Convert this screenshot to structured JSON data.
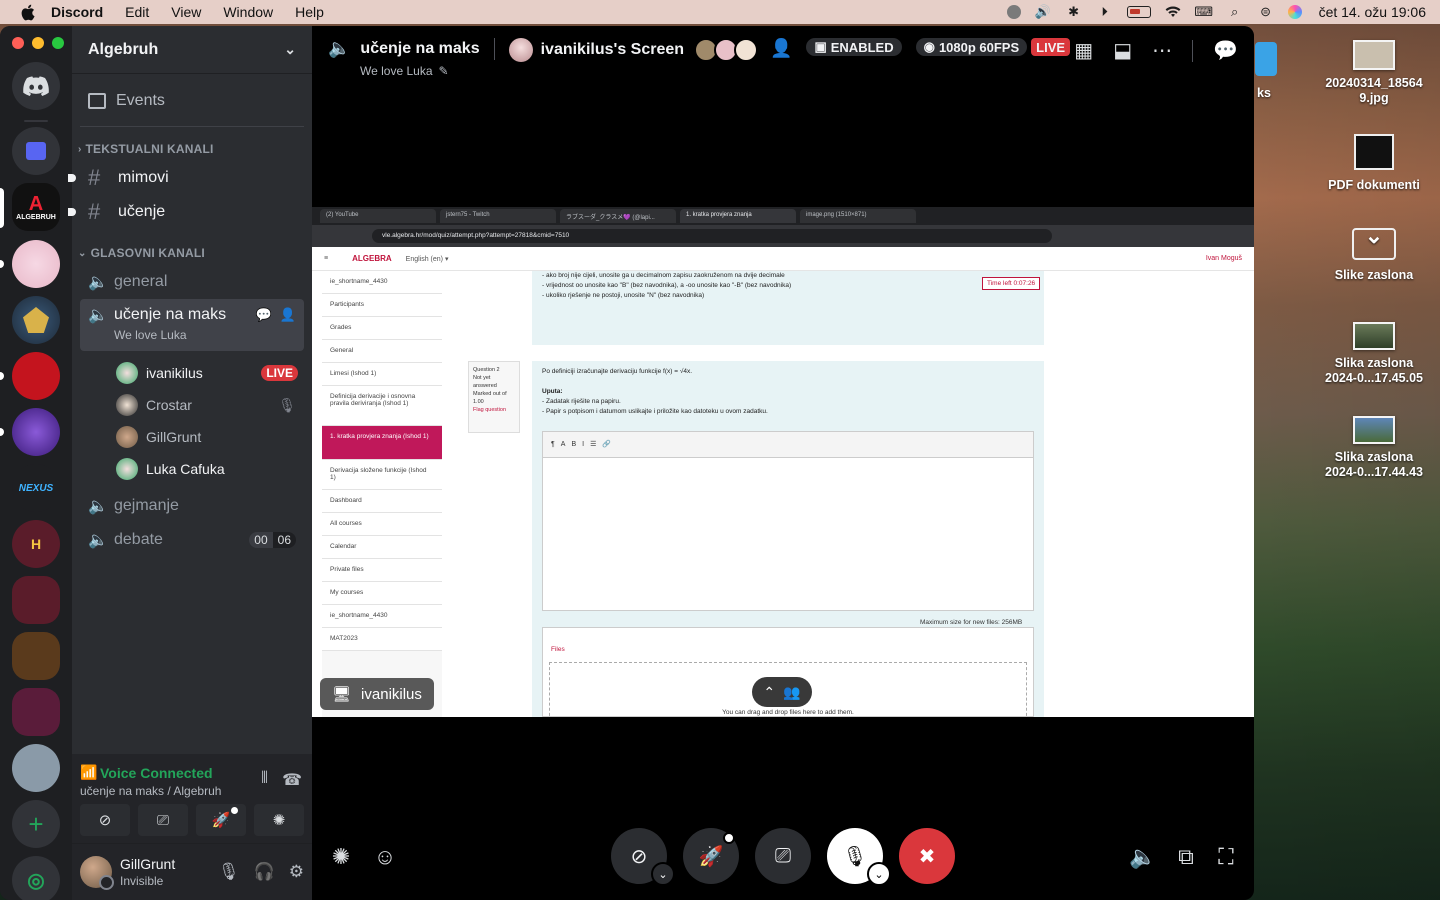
{
  "menubar": {
    "app_name": "Discord",
    "items": [
      "Edit",
      "View",
      "Window",
      "Help"
    ],
    "clock": "čet 14. ožu  19:06"
  },
  "desktop": {
    "items": [
      {
        "label": "20240314_18564\n9.jpg"
      },
      {
        "label": "PDF dokumenti"
      },
      {
        "label": "Slike zaslona"
      },
      {
        "label": "Slika zaslona\n2024-0...17.45.05"
      },
      {
        "label": "Slika zaslona\n2024-0...17.44.43"
      }
    ],
    "partial_label": "ks"
  },
  "server": {
    "name": "Algebruh",
    "events_label": "Events",
    "text_category": "TEKSTUALNI KANALI",
    "text_channels": [
      "mimovi",
      "učenje"
    ],
    "voice_category": "GLASOVNI KANALI",
    "voice_channels": {
      "general": "general",
      "active": {
        "name": "učenje na maks",
        "status": "We love Luka"
      },
      "gaming": "gejmanje",
      "debate": "debate",
      "debate_count": [
        "00",
        "06"
      ]
    },
    "vc_users": [
      {
        "name": "ivanikilus",
        "live": "LIVE"
      },
      {
        "name": "Crostar"
      },
      {
        "name": "GillGrunt"
      },
      {
        "name": "Luka Cafuka"
      }
    ]
  },
  "rail": {
    "algebruh_label": "ALGEBRUH",
    "nexus_label": "NEXUS",
    "h_label": "H"
  },
  "voice_panel": {
    "status": "Voice Connected",
    "where": "učenje na maks / Algebruh"
  },
  "user": {
    "name": "GillGrunt",
    "status": "Invisible"
  },
  "stage": {
    "channel": "učenje na maks",
    "channel_status": "We love Luka",
    "screen_title": "ivanikilus's Screen",
    "enabled_badge": "ENABLED",
    "quality_badge": "1080p 60FPS",
    "live_badge": "LIVE",
    "stream_tag": "ivanikilus"
  },
  "shared_screen": {
    "tabs": [
      "(2) YouTube",
      "jstern75 - Twitch",
      "ラブスーダ_クラスメ💜 (@lapi...",
      "1. kratka provjera znanja",
      "image.png (1510×871)"
    ],
    "url": "vle.algebra.hr/mod/quiz/attempt.php?attempt=27818&cmid=7510",
    "logo": "ALGEBRA",
    "language": "English (en) ▾",
    "user": "Ivan Moguš",
    "nav": [
      "ie_shortname_4430",
      "Participants",
      "Grades",
      "General",
      "Limesi (Ishod 1)",
      "Definicija derivacije i osnovna pravila deriviranja (Ishod 1)",
      "1. kratka provjera znanja (Ishod 1)",
      "Derivacija složene funkcije (Ishod 1)",
      "Dashboard",
      "All courses",
      "Calendar",
      "Private files",
      "My courses",
      "ie_shortname_4430",
      "MAT2023"
    ],
    "nav_selected": "1. kratka provjera znanja (Ishod 1)",
    "top_text": [
      "- ako broj nije cijeli, unosite ga u decimalnom zapisu zaokruženom na dvije decimale",
      "- vrijednost oo unosite kao \"B\" (bez navodnika), a -oo unosite kao \"-B\" (bez navodnika)",
      "- ukoliko rješenje ne postoji, unosite \"N\" (bez navodnika)"
    ],
    "time_left": "Time left 0:07:26",
    "question_info": [
      "Question 2",
      "Not yet answered",
      "Marked out of 1.00",
      "Flag question"
    ],
    "question_text": "Po definiciji izračunajte derivaciju funkcije  f(x) = √4x.",
    "uputa_title": "Uputa:",
    "uputa_lines": [
      "- Zadatak riješite na papiru.",
      "- Papir s potpisom i datumom uslikajte i priložite kao datoteku u ovom zadatku."
    ],
    "max_size": "Maximum size for new files: 256MB",
    "files_label": "Files",
    "drop_text": "You can drag and drop files here to add them."
  }
}
